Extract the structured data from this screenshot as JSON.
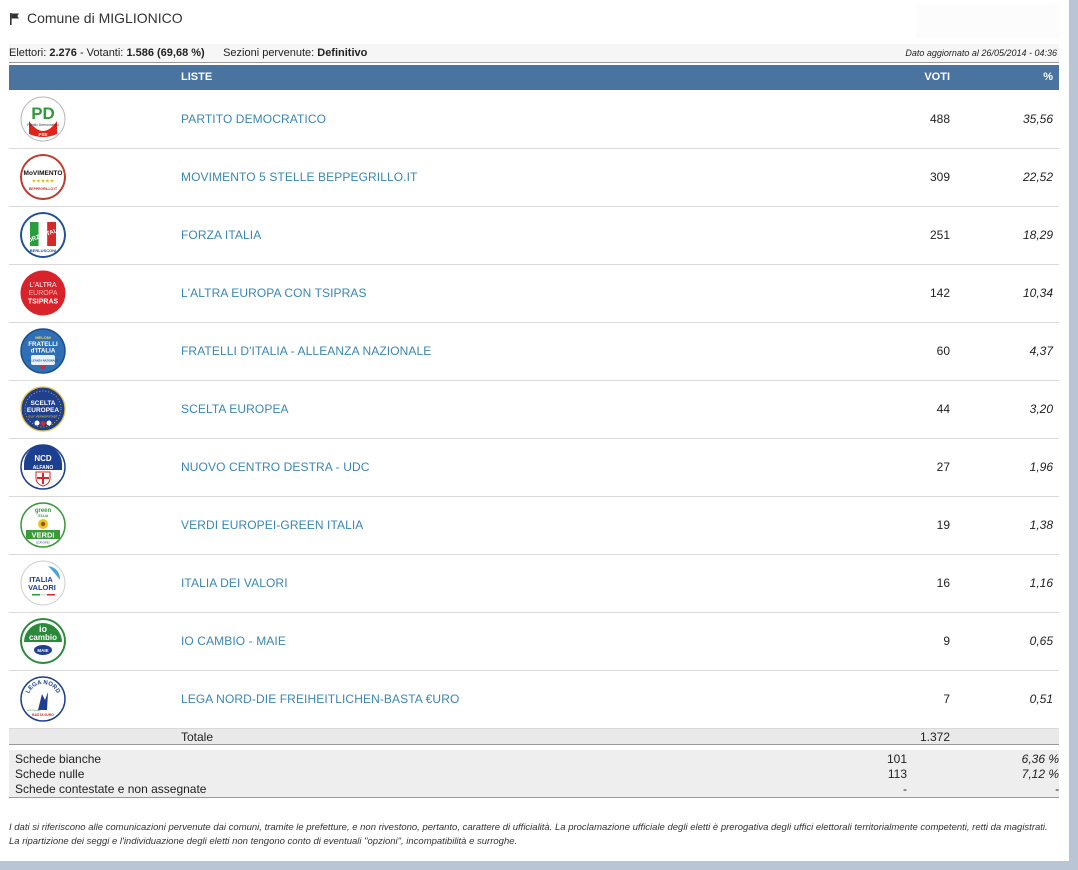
{
  "header": {
    "title": "Comune di MIGLIONICO"
  },
  "info": {
    "elettori_label": "Elettori:",
    "elettori_value": "2.276",
    "votanti_label": "- Votanti:",
    "votanti_value": "1.586 (69,68 %)",
    "sezioni_label": "Sezioni pervenute:",
    "sezioni_value": "Definitivo",
    "updated": "Dato aggiornato al 26/05/2014 - 04:36"
  },
  "table": {
    "col_liste": "LISTE",
    "col_voti": "VOTI",
    "col_perc": "%",
    "rows": [
      {
        "name": "PARTITO DEMOCRATICO",
        "votes": "488",
        "perc": "35,56",
        "logo": "pd-logo"
      },
      {
        "name": "MOVIMENTO 5 STELLE BEPPEGRILLO.IT",
        "votes": "309",
        "perc": "22,52",
        "logo": "m5s-logo"
      },
      {
        "name": "FORZA ITALIA",
        "votes": "251",
        "perc": "18,29",
        "logo": "fi-logo"
      },
      {
        "name": "L'ALTRA EUROPA CON TSIPRAS",
        "votes": "142",
        "perc": "10,34",
        "logo": "tsipras-logo"
      },
      {
        "name": "FRATELLI D'ITALIA - ALLEANZA NAZIONALE",
        "votes": "60",
        "perc": "4,37",
        "logo": "fdi-logo"
      },
      {
        "name": "SCELTA EUROPEA",
        "votes": "44",
        "perc": "3,20",
        "logo": "scelta-logo"
      },
      {
        "name": "NUOVO CENTRO DESTRA - UDC",
        "votes": "27",
        "perc": "1,96",
        "logo": "ncd-logo"
      },
      {
        "name": "VERDI EUROPEI-GREEN ITALIA",
        "votes": "19",
        "perc": "1,38",
        "logo": "verdi-logo"
      },
      {
        "name": "ITALIA DEI VALORI",
        "votes": "16",
        "perc": "1,16",
        "logo": "idv-logo"
      },
      {
        "name": "IO CAMBIO - MAIE",
        "votes": "9",
        "perc": "0,65",
        "logo": "iocambio-logo"
      },
      {
        "name": "LEGA NORD-DIE FREIHEITLICHEN-BASTA €URO",
        "votes": "7",
        "perc": "0,51",
        "logo": "lega-logo"
      }
    ],
    "total_label": "Totale",
    "total_value": "1.372"
  },
  "schede": [
    {
      "label": "Schede bianche",
      "value": "101",
      "perc": "6,36 %"
    },
    {
      "label": "Schede nulle",
      "value": "113",
      "perc": "7,12 %"
    },
    {
      "label": "Schede contestate e non assegnate",
      "value": "-",
      "perc": "-"
    }
  ],
  "logo_text": {
    "pd": "PD",
    "pd_sub": "Partito Democratico",
    "pd_pse": "PSE",
    "m5s": "MoVIMENTO",
    "m5s_sub": "BEPPEGRILLO.IT",
    "fi": "FORZA ITALIA",
    "fi_sub": "BERLUSCONI",
    "tsipras_1": "L'ALTRA",
    "tsipras_2": "EUROPA",
    "tsipras_3": "TSIPRAS",
    "fdi_1": "MELONI",
    "fdi_2": "FRATELLI",
    "fdi_3": "d'ITALIA",
    "fdi_4": "ALLEANZA NAZIONALE",
    "scelta_1": "SCELTA",
    "scelta_2": "EUROPEA",
    "scelta_3": "GUY VERHOFSTADT",
    "ncd_1": "NCD",
    "ncd_2": "ALFANO",
    "verdi_1": "green",
    "verdi_2": "ITALIA",
    "verdi_3": "VERDI",
    "verdi_4": "EUROPEI",
    "idv_1": "ITALIA",
    "idv_2": "VALORI",
    "iocambio_1": "io",
    "iocambio_2": "cambio",
    "iocambio_3": "MAIE",
    "lega_1": "LEGA NORD",
    "lega_2": "BASTA €URO",
    "lega_3": "AUTONOMIE"
  },
  "footnote": "I dati si riferiscono alle comunicazioni pervenute dai comuni, tramite le prefetture, e non rivestono, pertanto, carattere di ufficialità. La proclamazione ufficiale degli eletti è prerogativa degli uffici elettorali territorialmente competenti, retti da magistrati. La ripartizione dei seggi e l'individuazione degli eletti non tengono conto di eventuali \"opzioni\", incompatibilità e surroghe.",
  "colors": {
    "header_blue": "#4a73a0",
    "link_blue": "#3a86b4"
  }
}
